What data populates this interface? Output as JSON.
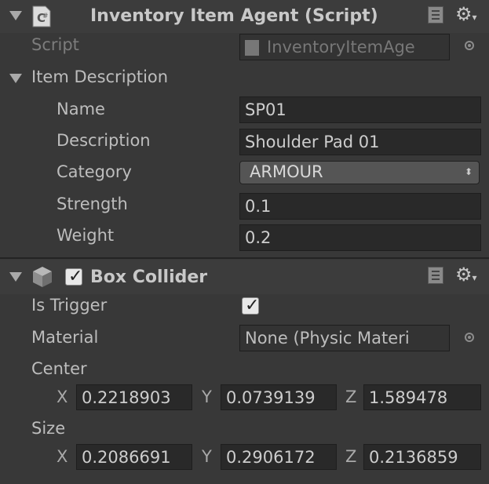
{
  "inventory_component": {
    "title": "Inventory Item Agent (Script)",
    "script_label": "Script",
    "script_value": "InventoryItemAge",
    "section_label": "Item Description",
    "fields": {
      "name_label": "Name",
      "name_value": "SP01",
      "description_label": "Description",
      "description_value": "Shoulder Pad 01",
      "category_label": "Category",
      "category_value": "ARMOUR",
      "strength_label": "Strength",
      "strength_value": "0.1",
      "weight_label": "Weight",
      "weight_value": "0.2"
    }
  },
  "box_collider": {
    "title": "Box Collider",
    "enabled": true,
    "is_trigger_label": "Is Trigger",
    "is_trigger": true,
    "material_label": "Material",
    "material_value": "None (Physic Materi",
    "center_label": "Center",
    "center": {
      "x_label": "X",
      "x": "0.2218903",
      "y_label": "Y",
      "y": "0.0739139",
      "z_label": "Z",
      "z": "1.589478"
    },
    "size_label": "Size",
    "size": {
      "x_label": "X",
      "x": "0.2086691",
      "y_label": "Y",
      "y": "0.2906172",
      "z_label": "Z",
      "z": "0.2136859"
    }
  },
  "icons": {
    "foldout": "triangle-down",
    "script": "csharp-script-icon",
    "help": "book-help-icon",
    "settings": "gear-icon",
    "object_picker": "target-icon",
    "cube": "cube-icon"
  },
  "colors": {
    "background": "#383838",
    "field": "#292929",
    "text": "#bdbdbd"
  }
}
